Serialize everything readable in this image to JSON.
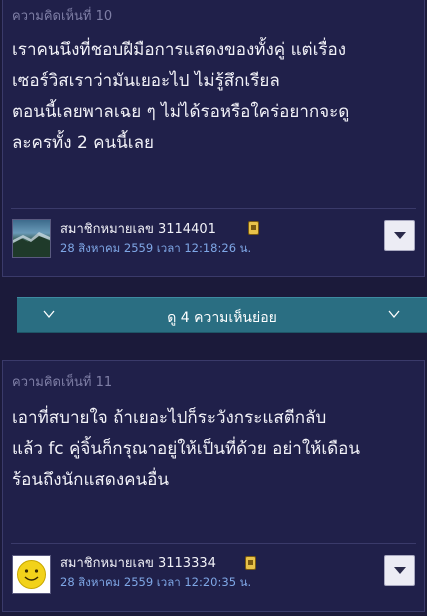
{
  "comments": [
    {
      "label": "ความคิดเห็นที่ 10",
      "body_lines": [
        "เราคนนึงที่ชอบฝีมือการแสดงของทั้งคู่ แต่เรื่อง",
        "เซอร์วิสเราว่ามันเยอะไป ไม่รู้สึกเรียล",
        "ตอนนี้เลยพาลเฉย ๆ  ไม่ได้รอหรือใคร่อยากจะดู",
        "ละครทั้ง 2 คนนี้เลย"
      ],
      "member": "สมาชิกหมายเลข 3114401",
      "date": "28 สิงหาคม 2559 เวลา 12:18:26 น.",
      "avatar_icon": "landscape-photo"
    },
    {
      "label": "ความคิดเห็นที่ 11",
      "body_lines": [
        "เอาที่สบายใจ ถ้าเยอะไปก็ระวังกระแสตีกลับ",
        "แล้ว fc คู่จิ้นก็กรุณาอยู่ให้เป็นที่ด้วย อย่าให้เดือน",
        "ร้อนถึงนักแสดงคนอื่น"
      ],
      "member": "สมาชิกหมายเลข 3113334",
      "date": "28 สิงหาคม 2559 เวลา 12:20:35 น.",
      "avatar_icon": "smiley-face"
    }
  ],
  "expand_replies": {
    "label": "ดู 4 ความเห็นย่อย",
    "icon": "chevron-down"
  },
  "colors": {
    "background": "#1b1a3a",
    "card": "#20204a",
    "expand_bar": "#2a6e82",
    "date_text": "#7fa7e6",
    "label_text": "#7f7fa6"
  }
}
